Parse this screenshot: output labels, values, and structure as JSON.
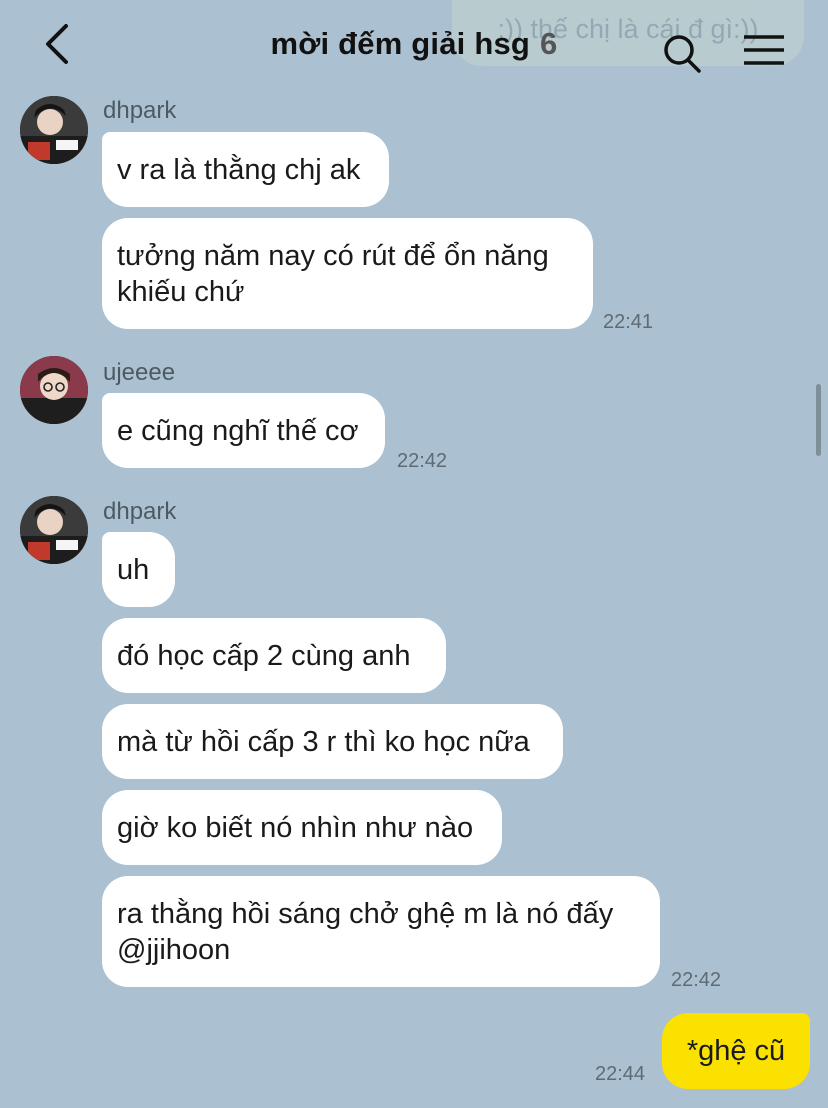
{
  "header": {
    "back_icon": "chevron-left-icon",
    "title": "mời đếm giải hsg",
    "member_count": "6",
    "search_icon": "search-icon",
    "menu_icon": "hamburger-menu-icon"
  },
  "ghost_message": ":)) thế chị là cái đ gì:))",
  "groups": [
    {
      "sender": "dhpark",
      "messages": [
        "v ra là thằng chj ak",
        "tưởng năm nay có rút để ổn năng khiếu chứ"
      ],
      "time": "22:41"
    },
    {
      "sender": "ujeeee",
      "messages": [
        "e cũng nghĩ thế cơ"
      ],
      "time": "22:42"
    },
    {
      "sender": "dhpark",
      "messages": [
        "uh",
        "đó học cấp 2 cùng anh",
        "mà từ hồi cấp 3 r thì ko học nữa",
        "giờ ko biết nó nhìn như nào",
        "ra thằng hồi sáng chở ghệ m là nó đấy @jjihoon"
      ],
      "time": "22:42"
    }
  ],
  "my_message": {
    "text": "*ghệ cũ",
    "time": "22:44",
    "color": "#fae100"
  },
  "colors": {
    "background": "#abc1d1",
    "bubble": "#ffffff"
  }
}
